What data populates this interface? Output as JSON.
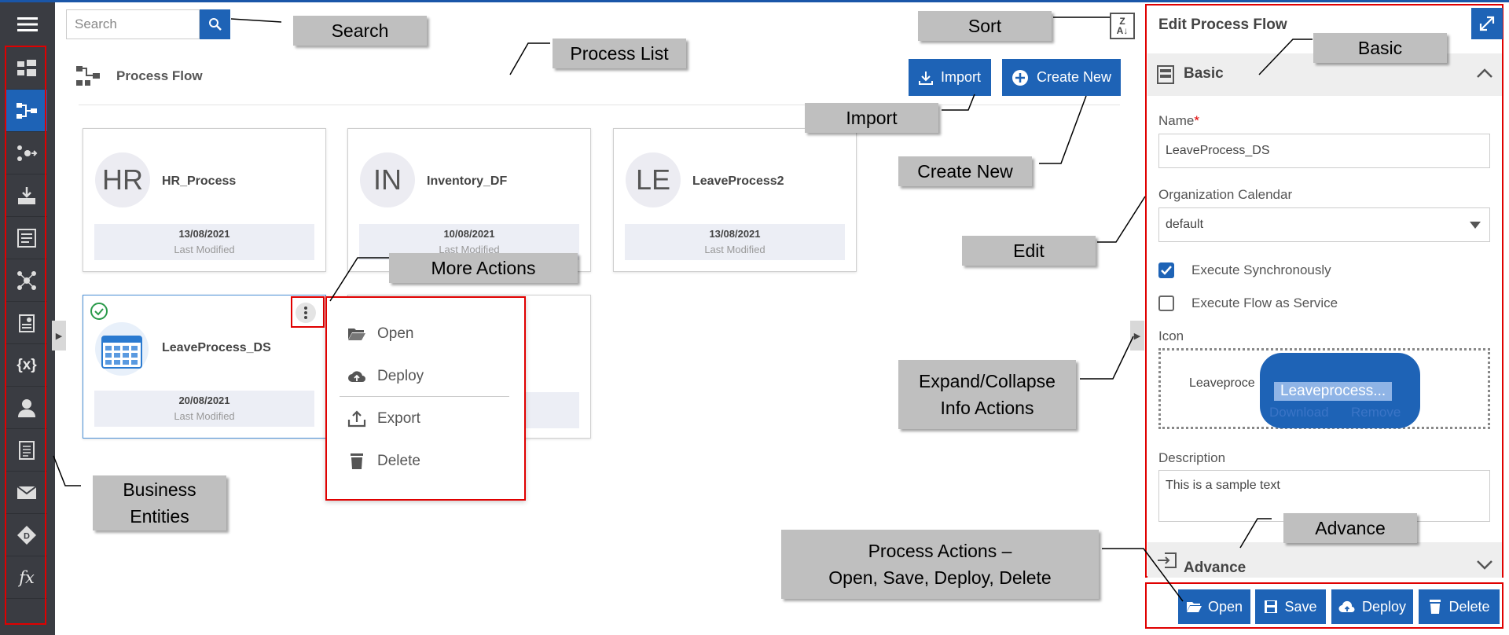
{
  "search": {
    "placeholder": "Search"
  },
  "header": {
    "title": "Process Flow",
    "import_label": "Import",
    "create_label": "Create New"
  },
  "cards": [
    {
      "initials": "HR",
      "name": "HR_Process",
      "date": "13/08/2021",
      "sub": "Last Modified"
    },
    {
      "initials": "IN",
      "name": "Inventory_DF",
      "date": "10/08/2021",
      "sub": "Last Modified"
    },
    {
      "initials": "LE",
      "name": "LeaveProcess2",
      "date": "13/08/2021",
      "sub": "Last Modified"
    },
    {
      "initials": "",
      "name": "LeaveProcess_DS",
      "date": "20/08/2021",
      "sub": "Last Modified"
    }
  ],
  "menu": {
    "items": [
      "Open",
      "Deploy",
      "Export",
      "Delete"
    ]
  },
  "panel": {
    "title": "Edit Process Flow",
    "basic_label": "Basic",
    "name_label": "Name",
    "required_mark": "*",
    "name_value": "LeaveProcess_DS",
    "calendar_label": "Organization Calendar",
    "calendar_value": "default",
    "sync_label": "Execute Synchronously",
    "sync_checked": true,
    "service_label": "Execute Flow as Service",
    "service_checked": false,
    "icon_label": "Icon",
    "icon_filename": "Leaveproce",
    "icon_popup_name": "Leaveprocess...",
    "icon_download": "Download",
    "icon_remove": "Remove",
    "desc_label": "Description",
    "desc_value": "This is a sample text",
    "advance_label": "Advance"
  },
  "actions": {
    "open": "Open",
    "save": "Save",
    "deploy": "Deploy",
    "delete": "Delete"
  },
  "callouts": {
    "search": "Search",
    "process_list": "Process List",
    "sort": "Sort",
    "basic": "Basic",
    "import": "Import",
    "create_new": "Create New",
    "more_actions": "More Actions",
    "edit": "Edit",
    "expand_collapse": "Expand/Collapse\nInfo Actions",
    "advance": "Advance",
    "process_actions": "Process Actions –\nOpen, Save, Deploy, Delete",
    "business_entities": "Business\nEntities"
  },
  "colors": {
    "accent": "#1e63b6",
    "sidebar": "#3a3c42",
    "highlight": "#e00000",
    "callout": "#bfbfbf"
  }
}
